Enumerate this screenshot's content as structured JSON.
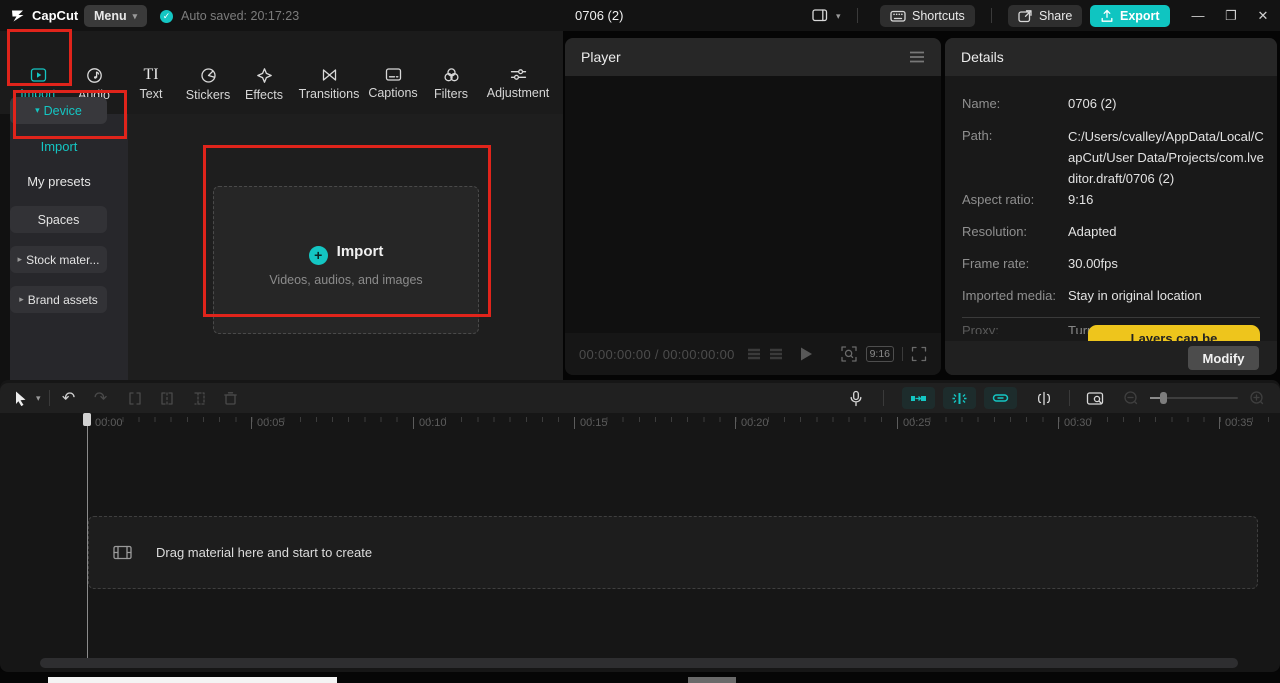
{
  "titlebar": {
    "logo_text": "CapCut",
    "menu_label": "Menu",
    "autosave_text": "Auto saved: 20:17:23",
    "project_title": "0706 (2)",
    "shortcuts_label": "Shortcuts",
    "share_label": "Share",
    "export_label": "Export"
  },
  "toolbar": {
    "items": [
      {
        "label": "Import"
      },
      {
        "label": "Audio"
      },
      {
        "label": "Text"
      },
      {
        "label": "Stickers"
      },
      {
        "label": "Effects"
      },
      {
        "label": "Transitions"
      },
      {
        "label": "Captions"
      },
      {
        "label": "Filters"
      },
      {
        "label": "Adjustment"
      }
    ]
  },
  "sidebar": {
    "items": [
      {
        "label": "Device"
      },
      {
        "label": "Import"
      },
      {
        "label": "My presets"
      },
      {
        "label": "Spaces"
      },
      {
        "label": "Stock mater..."
      },
      {
        "label": "Brand assets"
      }
    ]
  },
  "import_zone": {
    "title": "Import",
    "subtitle": "Videos, audios, and images"
  },
  "player": {
    "title": "Player",
    "time_text": "00:00:00:00 / 00:00:00:00",
    "ratio_label": "9:16"
  },
  "details": {
    "title": "Details",
    "rows": [
      {
        "label": "Name:",
        "value": "0706 (2)"
      },
      {
        "label": "Path:",
        "value": "C:/Users/cvalley/AppData/Local/CapCut/User Data/Projects/com.lveditor.draft/0706 (2)"
      },
      {
        "label": "Aspect ratio:",
        "value": "9:16"
      },
      {
        "label": "Resolution:",
        "value": "Adapted"
      },
      {
        "label": "Frame rate:",
        "value": "30.00fps"
      },
      {
        "label": "Imported media:",
        "value": "Stay in original location"
      },
      {
        "label": "Proxy:",
        "value": "Turned off"
      }
    ],
    "tooltip_text": "Layers can be",
    "modify_label": "Modify"
  },
  "timeline": {
    "ruler_labels": [
      "00:00",
      "00:05",
      "00:10",
      "00:15",
      "00:20",
      "00:25",
      "00:30",
      "00:35"
    ],
    "drop_hint": "Drag material here and start to create"
  },
  "colors": {
    "accent_teal": "#14c6c3",
    "highlight_red": "#e0241b",
    "tooltip_yellow": "#eec51c",
    "export_button": "#0fc5c1"
  }
}
